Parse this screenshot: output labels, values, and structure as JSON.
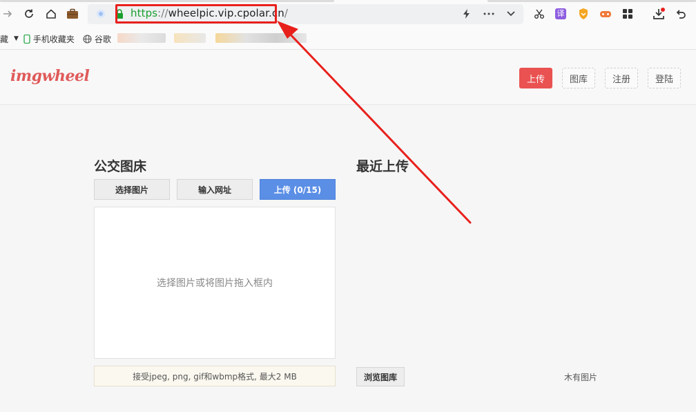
{
  "browser": {
    "url_protocol": "https",
    "url_separator": "://",
    "url_host": "wheelpic.vip.cpolar.cn",
    "url_trailing": "/",
    "translate_icon_text": "译"
  },
  "bookmarks": {
    "truncated_item": "藏",
    "mobile_favorites": "手机收藏夹",
    "google": "谷歌"
  },
  "site": {
    "logo_part1": "img",
    "logo_part2": "wheel",
    "nav": {
      "upload": "上传",
      "gallery": "图库",
      "register": "注册",
      "login": "登陆"
    }
  },
  "left_panel": {
    "title": "公交图床",
    "tabs": {
      "choose": "选择图片",
      "url": "输入网址",
      "upload": "上传 (0/15)"
    },
    "drop_hint": "选择图片或将图片拖入框内",
    "notice": "接受jpeg, png, gif和wbmp格式, 最大2 MB"
  },
  "right_panel": {
    "title": "最近上传",
    "browse_button": "浏览图库",
    "empty_text": "木有图片"
  },
  "colors": {
    "accent_red": "#ea5151",
    "primary_blue": "#5b8fe6",
    "annotation_red": "#e8201c"
  }
}
